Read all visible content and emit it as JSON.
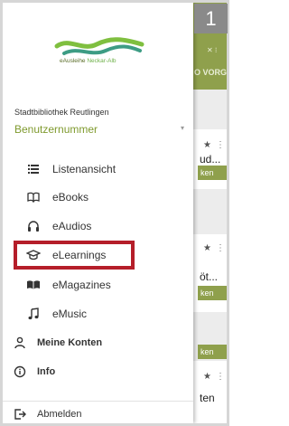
{
  "badge_number": "1",
  "logo": {
    "text_main": "eAusleihe ",
    "text_accent": "Neckar-Alb"
  },
  "library_name": "Stadtbibliothek Reutlingen",
  "account": {
    "label": "Benutzernummer"
  },
  "menu": {
    "list_view": "Listenansicht",
    "ebooks": "eBooks",
    "eaudios": "eAudios",
    "elearnings": "eLearnings",
    "emagazines": "eMagazines",
    "emusic": "eMusic",
    "my_accounts": "Meine Konten",
    "info": "Info",
    "logout": "Abmelden"
  },
  "background": {
    "tab_text": "O VORG",
    "card_titles": [
      "ud...",
      "öt...",
      "ten"
    ],
    "button_label": "ken"
  },
  "colors": {
    "brand_green": "#8fa04c",
    "accent_green": "#7f9a2e",
    "highlight_red": "#b51e2a"
  }
}
